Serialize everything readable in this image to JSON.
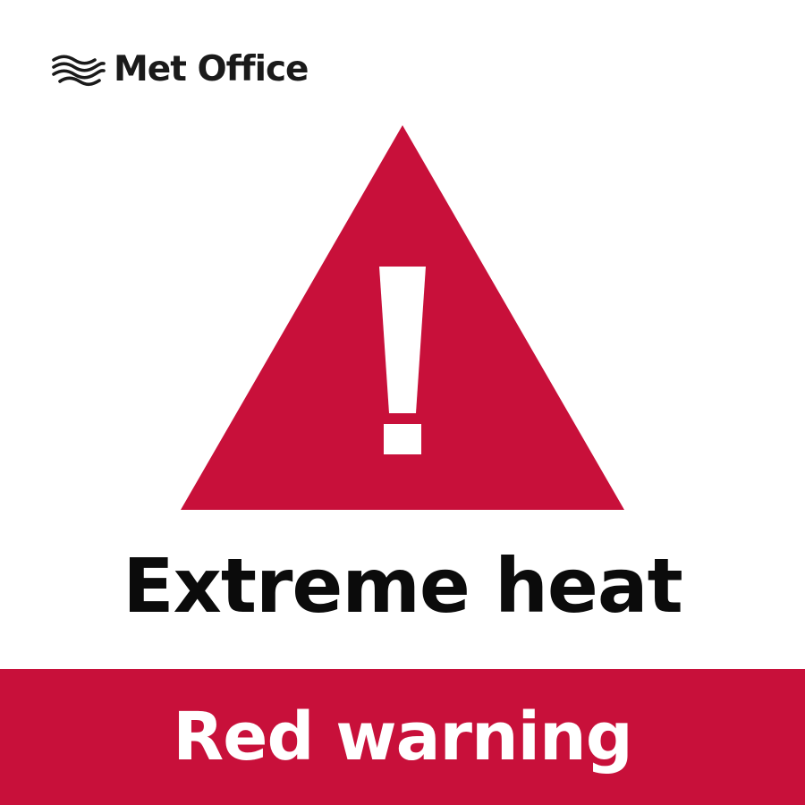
{
  "brand": {
    "name": "Met Office",
    "logo_icon": "wave-lines-icon"
  },
  "warning": {
    "icon": "exclamation-warning-triangle-icon",
    "title": "Extreme heat",
    "level": "Red warning"
  },
  "colors": {
    "warning_red": "#c8103a",
    "text_black": "#0b0b0b",
    "background": "#ffffff"
  }
}
